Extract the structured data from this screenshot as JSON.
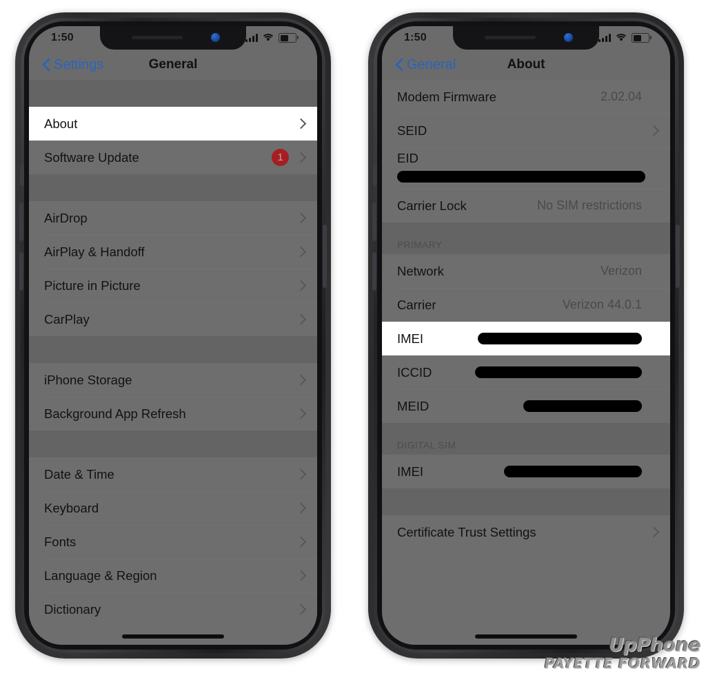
{
  "colors": {
    "accent_blue": "#2a64bb",
    "badge_red": "#a51f22",
    "screen_gray": "#6e6e6e",
    "highlight": "#ffffff"
  },
  "watermark": {
    "line1": "UpPhone",
    "line2": "PAYETTE FORWARD"
  },
  "phones": [
    {
      "status": {
        "time": "1:50"
      },
      "nav": {
        "back_label": "Settings",
        "title": "General"
      },
      "sections": [
        {
          "header": "",
          "rows": [
            {
              "label": "About",
              "value": "",
              "chevron": true,
              "highlight": true,
              "badge": ""
            },
            {
              "label": "Software Update",
              "value": "",
              "chevron": true,
              "highlight": false,
              "badge": "1"
            }
          ]
        },
        {
          "header": "",
          "rows": [
            {
              "label": "AirDrop",
              "value": "",
              "chevron": true,
              "highlight": false,
              "badge": ""
            },
            {
              "label": "AirPlay & Handoff",
              "value": "",
              "chevron": true,
              "highlight": false,
              "badge": ""
            },
            {
              "label": "Picture in Picture",
              "value": "",
              "chevron": true,
              "highlight": false,
              "badge": ""
            },
            {
              "label": "CarPlay",
              "value": "",
              "chevron": true,
              "highlight": false,
              "badge": ""
            }
          ]
        },
        {
          "header": "",
          "rows": [
            {
              "label": "iPhone Storage",
              "value": "",
              "chevron": true,
              "highlight": false,
              "badge": ""
            },
            {
              "label": "Background App Refresh",
              "value": "",
              "chevron": true,
              "highlight": false,
              "badge": ""
            }
          ]
        },
        {
          "header": "",
          "rows": [
            {
              "label": "Date & Time",
              "value": "",
              "chevron": true,
              "highlight": false,
              "badge": ""
            },
            {
              "label": "Keyboard",
              "value": "",
              "chevron": true,
              "highlight": false,
              "badge": ""
            },
            {
              "label": "Fonts",
              "value": "",
              "chevron": true,
              "highlight": false,
              "badge": ""
            },
            {
              "label": "Language & Region",
              "value": "",
              "chevron": true,
              "highlight": false,
              "badge": ""
            },
            {
              "label": "Dictionary",
              "value": "",
              "chevron": true,
              "highlight": false,
              "badge": ""
            }
          ]
        }
      ]
    },
    {
      "status": {
        "time": "1:50"
      },
      "nav": {
        "back_label": "General",
        "title": "About"
      },
      "sections": [
        {
          "header": "",
          "rows": [
            {
              "label": "Modem Firmware",
              "value": "2.02.04",
              "chevron": false,
              "highlight": false,
              "redact": 0,
              "stacked": false
            },
            {
              "label": "SEID",
              "value": "",
              "chevron": true,
              "highlight": false,
              "redact": 0,
              "stacked": false
            },
            {
              "label": "EID",
              "value": "",
              "chevron": false,
              "highlight": false,
              "redact": 360,
              "stacked": true
            },
            {
              "label": "Carrier Lock",
              "value": "No SIM restrictions",
              "chevron": false,
              "highlight": false,
              "redact": 0,
              "stacked": false
            }
          ]
        },
        {
          "header": "PRIMARY",
          "rows": [
            {
              "label": "Network",
              "value": "Verizon",
              "chevron": false,
              "highlight": false,
              "redact": 0,
              "stacked": false
            },
            {
              "label": "Carrier",
              "value": "Verizon 44.0.1",
              "chevron": false,
              "highlight": false,
              "redact": 0,
              "stacked": false
            },
            {
              "label": "IMEI",
              "value": "",
              "chevron": false,
              "highlight": true,
              "redact": 238,
              "stacked": false
            },
            {
              "label": "ICCID",
              "value": "",
              "chevron": false,
              "highlight": false,
              "redact": 242,
              "stacked": false
            },
            {
              "label": "MEID",
              "value": "",
              "chevron": false,
              "highlight": false,
              "redact": 172,
              "stacked": false
            }
          ]
        },
        {
          "header": "DIGITAL SIM",
          "rows": [
            {
              "label": "IMEI",
              "value": "",
              "chevron": false,
              "highlight": false,
              "redact": 200,
              "stacked": false
            }
          ]
        },
        {
          "header": "",
          "rows": [
            {
              "label": "Certificate Trust Settings",
              "value": "",
              "chevron": true,
              "highlight": false,
              "redact": 0,
              "stacked": false
            }
          ]
        }
      ]
    }
  ]
}
